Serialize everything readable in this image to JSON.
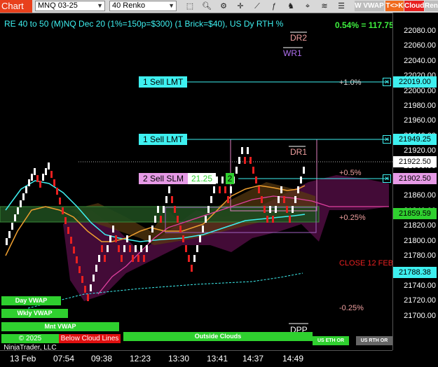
{
  "toolbar": {
    "chart_label": "Chart",
    "instrument": "MNQ 03-25",
    "bar_type": "40 Renko",
    "btn_wvwap": "W VWAP",
    "btn_tk": "T<>K",
    "btn_cloud": "Cloud",
    "btn_renko": "Renko"
  },
  "chart": {
    "title": "RE 40 to 50 (M)NQ Dec 20 (1%=150p=$300) (1 Brick=$40), US Dy RTH %",
    "pct_change": "0.54% = 117.75",
    "price_ticks": [
      "22080.00",
      "22060.00",
      "22040.00",
      "22020.00",
      "22000.00",
      "21980.00",
      "21960.00",
      "21940.00",
      "21920.00",
      "21900.00",
      "21880.00",
      "21860.00",
      "21840.00",
      "21820.00",
      "21800.00",
      "21780.00",
      "21760.00",
      "21740.00",
      "21720.00",
      "21700.00"
    ],
    "price_tags": {
      "sell1": "22019.00",
      "sell2": "21949.25",
      "last": "21922.50",
      "slm": "21902.50",
      "green": "21859.59",
      "close": "21788.38"
    },
    "time_ticks": [
      "13 Feb",
      "07:54",
      "09:38",
      "12:23",
      "13:30",
      "13:41",
      "14:37",
      "14:49"
    ],
    "orders": {
      "sell_lmt_1": "1 Sell LMT",
      "sell_lmt_2": "1 Sell LMT",
      "sell_slm": "2 Sell SLM",
      "slm_price": "21.25",
      "slm_qty": "2"
    },
    "levels": {
      "dr2": "DR2",
      "wr1": "WR1",
      "dr1": "DR1",
      "dpp": "DPP",
      "pct_p1": "+1.0%",
      "pct_p05": "+0.5%",
      "pct_p025": "+0.25%",
      "pct_m025": "-0.25%",
      "close_label": "CLOSE 12 FEB"
    },
    "bottom_bars": {
      "day_vwap": "Day VWAP",
      "wkly_vwap": "Wkly VWAP",
      "mnt_vwap": "Mnt VWAP",
      "copyright": "© 2025 NinjaTrader, LLC",
      "below_lines": "Below Cloud Lines",
      "outside_clouds": "Outside Clouds",
      "us_eth": "US ETH OR",
      "us_rth": "US RTH OR"
    },
    "colors": {
      "cyan": "#3ef0f0",
      "sell_tag": "#3ef0f0",
      "slm_tag": "#e69ae6",
      "green_tag": "#2fd02f",
      "close_tag": "#3ef0f0",
      "up_brick": "#ffffff",
      "down_brick": "#e82020"
    }
  }
}
